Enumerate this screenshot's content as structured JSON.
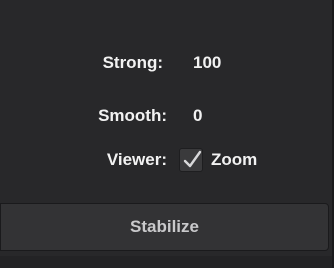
{
  "fields": {
    "strong": {
      "label": "Strong:",
      "value": "100"
    },
    "smooth": {
      "label": "Smooth:",
      "value": "0"
    },
    "viewer": {
      "label": "Viewer:",
      "option_label": "Zoom",
      "checked": true
    }
  },
  "actions": {
    "stabilize_label": "Stabilize"
  },
  "colors": {
    "panel_bg": "#28282a",
    "button_bg": "#333335",
    "text": "#f2f2f2",
    "button_text": "#c9c9cb"
  }
}
